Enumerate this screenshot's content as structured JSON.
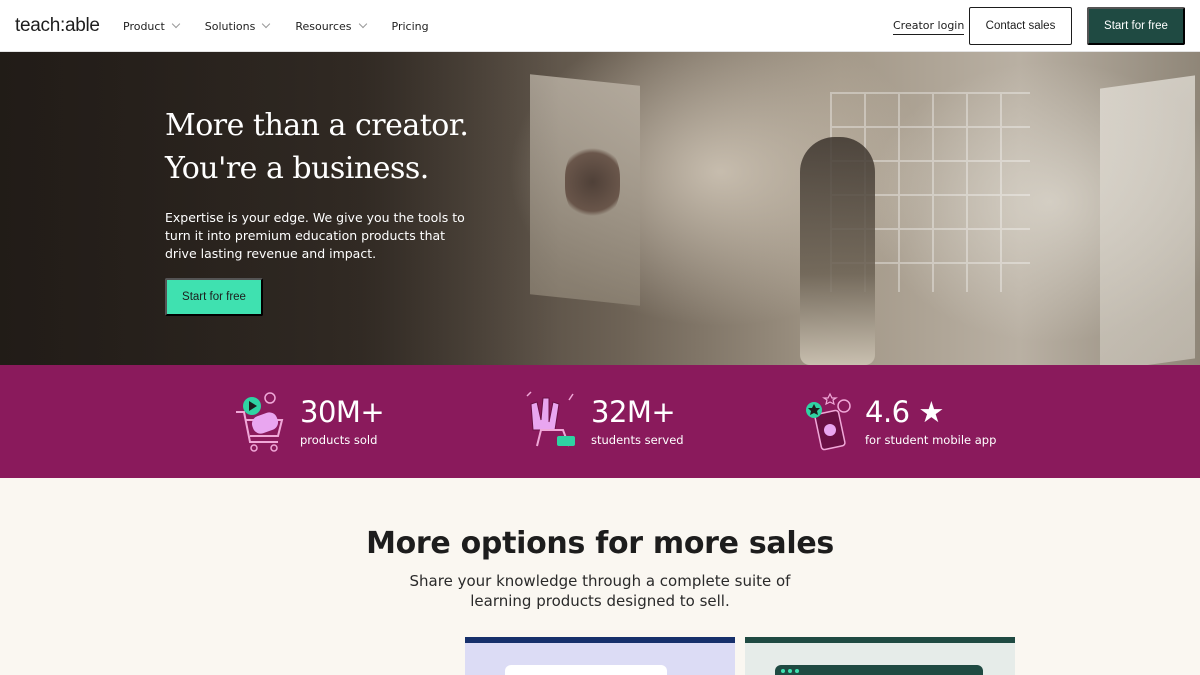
{
  "nav": {
    "logo": "teach:able",
    "items": [
      {
        "label": "Product",
        "has_dropdown": true
      },
      {
        "label": "Solutions",
        "has_dropdown": true
      },
      {
        "label": "Resources",
        "has_dropdown": true
      },
      {
        "label": "Pricing",
        "has_dropdown": false
      }
    ],
    "creator_login": "Creator login",
    "contact_sales": "Contact sales",
    "start_free": "Start for free"
  },
  "hero": {
    "title_line1": "More than a creator.",
    "title_line2": "You're a business.",
    "subtitle": "Expertise is your edge. We give you the tools to turn it into premium education products that drive lasting revenue and impact.",
    "cta": "Start for free"
  },
  "stats": [
    {
      "value": "30M+",
      "label": "products sold",
      "icon": "shopping-cart-icon"
    },
    {
      "value": "32M+",
      "label": "students served",
      "icon": "high-five-hands-icon"
    },
    {
      "value": "4.6 ★",
      "label": "for student mobile app",
      "icon": "mobile-app-rating-icon"
    }
  ],
  "section": {
    "title": "More options for more sales",
    "subtitle": "Share your knowledge through a complete suite of learning products designed to sell."
  },
  "colors": {
    "brand_dark_green": "#1f4a42",
    "mint": "#3fe1b0",
    "stats_magenta": "#8a1a5c",
    "card_navy": "#16306b",
    "page_bg": "#faf7f1"
  }
}
